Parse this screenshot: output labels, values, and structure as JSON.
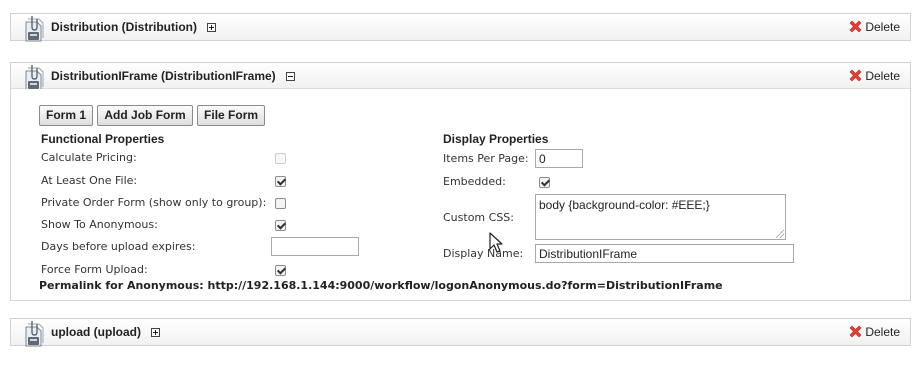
{
  "panels": [
    {
      "title": "Distribution (Distribution)",
      "delete_label": "Delete"
    },
    {
      "title": "DistributionIFrame (DistributionIFrame)",
      "delete_label": "Delete"
    },
    {
      "title": "upload (upload)",
      "delete_label": "Delete"
    }
  ],
  "form_tabs": [
    "Form 1",
    "Add Job Form",
    "File Form"
  ],
  "functional": {
    "title": "Functional Properties",
    "calculate_pricing": {
      "label": "Calculate Pricing:",
      "checked": false,
      "disabled": true
    },
    "at_least_one_file": {
      "label": "At Least One File:",
      "checked": true
    },
    "private_order_form": {
      "label": "Private Order Form (show only to group):",
      "checked": false
    },
    "show_to_anonymous": {
      "label": "Show To Anonymous:",
      "checked": true
    },
    "days_before_expire": {
      "label": "Days before upload expires:",
      "value": ""
    },
    "force_form_upload": {
      "label": "Force Form Upload:",
      "checked": true
    }
  },
  "display": {
    "title": "Display Properties",
    "items_per_page": {
      "label": "Items Per Page:",
      "value": "0"
    },
    "embedded": {
      "label": "Embedded:",
      "checked": true
    },
    "custom_css": {
      "label": "Custom CSS:",
      "value": "body {background-color: #EEE;}"
    },
    "display_name": {
      "label": "Display Name:",
      "value": "DistributionIFrame"
    }
  },
  "permalink": {
    "label": "Permalink for Anonymous:",
    "url": "http://192.168.1.144:9000/workflow/logonAnonymous.do?form=DistributionIFrame"
  },
  "colors": {
    "delete_x": "#e0403a",
    "panel_border": "#d3d3d3",
    "header_gradient_end": "#f1f1f1"
  },
  "icons": {
    "panel": "document-stack-icon",
    "delete": "red-x-icon",
    "collapsed": "plus-box-icon",
    "expanded": "minus-box-icon"
  }
}
